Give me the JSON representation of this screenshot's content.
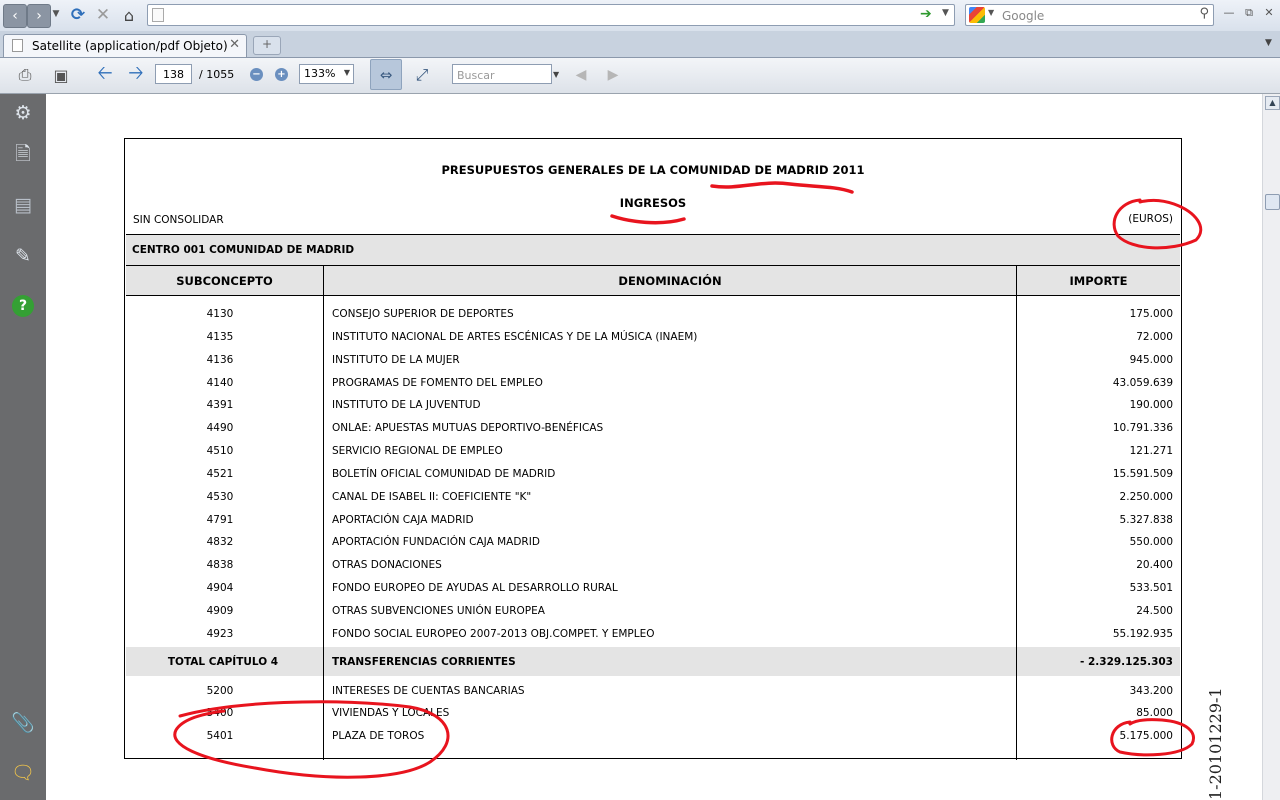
{
  "browser": {
    "url": "",
    "search_placeholder": "Google",
    "tab_title": "Satellite (application/pdf Objeto)"
  },
  "pdf_toolbar": {
    "current_page": "138",
    "total_pages": "/  1055",
    "zoom": "133%",
    "find_placeholder": "Buscar"
  },
  "document": {
    "title": "PRESUPUESTOS GENERALES DE LA COMUNIDAD DE MADRID 2011",
    "subtitle": "INGRESOS",
    "consolidation": "SIN CONSOLIDAR",
    "currency": "(EUROS)",
    "centre": "CENTRO 001 COMUNIDAD DE MADRID",
    "columns": {
      "subconcepto": "SUBCONCEPTO",
      "denominacion": "DENOMINACIÓN",
      "importe": "IMPORTE"
    },
    "rows": [
      {
        "code": "4130",
        "name": "CONSEJO SUPERIOR DE DEPORTES",
        "amount": "175.000"
      },
      {
        "code": "4135",
        "name": "INSTITUTO NACIONAL DE ARTES ESCÉNICAS Y DE LA MÚSICA (INAEM)",
        "amount": "72.000"
      },
      {
        "code": "4136",
        "name": "INSTITUTO DE LA MUJER",
        "amount": "945.000"
      },
      {
        "code": "4140",
        "name": "PROGRAMAS DE FOMENTO DEL EMPLEO",
        "amount": "43.059.639"
      },
      {
        "code": "4391",
        "name": "INSTITUTO DE LA JUVENTUD",
        "amount": "190.000"
      },
      {
        "code": "4490",
        "name": "ONLAE: APUESTAS MUTUAS DEPORTIVO-BENÉFICAS",
        "amount": "10.791.336"
      },
      {
        "code": "4510",
        "name": "SERVICIO REGIONAL DE EMPLEO",
        "amount": "121.271"
      },
      {
        "code": "4521",
        "name": "BOLETÍN OFICIAL COMUNIDAD DE MADRID",
        "amount": "15.591.509"
      },
      {
        "code": "4530",
        "name": "CANAL DE ISABEL II: COEFICIENTE \"K\"",
        "amount": "2.250.000"
      },
      {
        "code": "4791",
        "name": "APORTACIÓN CAJA MADRID",
        "amount": "5.327.838"
      },
      {
        "code": "4832",
        "name": "APORTACIÓN FUNDACIÓN CAJA MADRID",
        "amount": "550.000"
      },
      {
        "code": "4838",
        "name": "OTRAS DONACIONES",
        "amount": "20.400"
      },
      {
        "code": "4904",
        "name": "FONDO EUROPEO DE AYUDAS AL DESARROLLO RURAL",
        "amount": "533.501"
      },
      {
        "code": "4909",
        "name": "OTRAS SUBVENCIONES UNIÓN EUROPEA",
        "amount": "24.500"
      },
      {
        "code": "4923",
        "name": "FONDO SOCIAL EUROPEO 2007-2013 OBJ.COMPET. Y EMPLEO",
        "amount": "55.192.935"
      }
    ],
    "total": {
      "code": "TOTAL CAPÍTULO 4",
      "name": "TRANSFERENCIAS CORRIENTES",
      "amount": "- 2.329.125.303"
    },
    "rows_after": [
      {
        "code": "5200",
        "name": "INTERESES DE CUENTAS BANCARIAS",
        "amount": "343.200"
      },
      {
        "code": "5400",
        "name": "VIVIENDAS Y LOCALES",
        "amount": "85.000"
      },
      {
        "code": "5401",
        "name": "PLAZA DE TOROS",
        "amount": "5.175.000"
      }
    ],
    "side_stamp": "1-20101229-1"
  },
  "annotation_color": "#e8141e"
}
